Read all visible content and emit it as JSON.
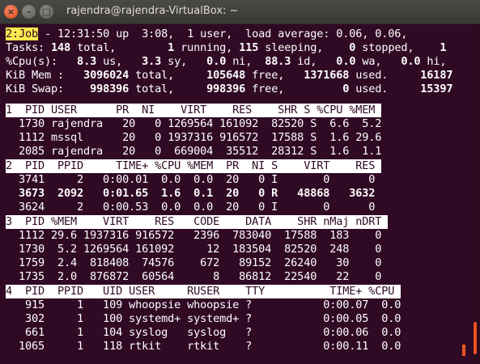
{
  "window": {
    "title": "rajendra@rajendra-VirtualBox: ~",
    "close_glyph": "×",
    "min_glyph": "–",
    "max_glyph": "□"
  },
  "summary": {
    "job_label": "2:Job",
    "line1_rest": " - 12:31:50 up  3:08,  1 user,  load average: 0.06, 0.06,",
    "tasks": {
      "label": "Tasks:",
      "total": "148",
      "running": "1",
      "sleeping": "115",
      "stopped": "0",
      "zombie": "1"
    },
    "cpu": {
      "label": "%Cpu(s):",
      "us": "8.3",
      "sy": "3.3",
      "ni": "0.0",
      "id": "88.3",
      "wa": "0.0",
      "hi": "0.0"
    },
    "mem": {
      "label": "KiB Mem :",
      "total": "3096024",
      "free": "105648",
      "used": "1371668",
      "buff": "16187"
    },
    "swap": {
      "label": "KiB Swap:",
      "total": "998396",
      "free": "998396",
      "used": "0",
      "avail": "15397"
    }
  },
  "window1": {
    "header": "1  PID USER      PR  NI    VIRT    RES    SHR S %CPU %MEM ",
    "rows": [
      {
        "pid": "1730",
        "user": "rajendra",
        "pr": "20",
        "ni": "0",
        "virt": "1269564",
        "res": "161092",
        "shr": "82520",
        "s": "S",
        "cpu": "6.6",
        "mem": "5.2"
      },
      {
        "pid": "1112",
        "user": "mssql",
        "pr": "20",
        "ni": "0",
        "virt": "1937316",
        "res": "916572",
        "shr": "17588",
        "s": "S",
        "cpu": "1.6",
        "mem": "29.6"
      },
      {
        "pid": "2085",
        "user": "rajendra",
        "pr": "20",
        "ni": "0",
        "virt": "669004",
        "res": "35512",
        "shr": "28312",
        "s": "S",
        "cpu": "1.6",
        "mem": "1.1"
      }
    ]
  },
  "window2": {
    "header": "2  PID  PPID     TIME+ %CPU %MEM  PR  NI S    VIRT    RES ",
    "rows": [
      {
        "pid": "3741",
        "ppid": "2",
        "time": "0:00.01",
        "cpu": "0.0",
        "mem": "0.0",
        "pr": "20",
        "ni": "0",
        "s": "I",
        "virt": "0",
        "res": "0",
        "bold": false
      },
      {
        "pid": "3673",
        "ppid": "2092",
        "time": "0:01.65",
        "cpu": "1.6",
        "mem": "0.1",
        "pr": "20",
        "ni": "0",
        "s": "R",
        "virt": "48868",
        "res": "3632",
        "bold": true
      },
      {
        "pid": "3624",
        "ppid": "2",
        "time": "0:00.53",
        "cpu": "0.0",
        "mem": "0.0",
        "pr": "20",
        "ni": "0",
        "s": "I",
        "virt": "0",
        "res": "0",
        "bold": false
      }
    ]
  },
  "window3": {
    "header": "3  PID %MEM    VIRT    RES   CODE    DATA    SHR nMaj nDRT ",
    "rows": [
      {
        "pid": "1112",
        "mem": "29.6",
        "virt": "1937316",
        "res": "916572",
        "code": "2396",
        "data": "783040",
        "shr": "17588",
        "nmaj": "183",
        "ndrt": "0"
      },
      {
        "pid": "1730",
        "mem": "5.2",
        "virt": "1269564",
        "res": "161092",
        "code": "12",
        "data": "183504",
        "shr": "82520",
        "nmaj": "248",
        "ndrt": "0"
      },
      {
        "pid": "1759",
        "mem": "2.4",
        "virt": "818408",
        "res": "74576",
        "code": "672",
        "data": "89152",
        "shr": "26240",
        "nmaj": "30",
        "ndrt": "0"
      },
      {
        "pid": "1735",
        "mem": "2.0",
        "virt": "876872",
        "res": "60564",
        "code": "8",
        "data": "86812",
        "shr": "22540",
        "nmaj": "22",
        "ndrt": "0"
      }
    ]
  },
  "window4": {
    "header": "4  PID  PPID   UID USER     RUSER    TTY          TIME+ %CPU ",
    "rows": [
      {
        "pid": "915",
        "ppid": "1",
        "uid": "109",
        "user": "whoopsie",
        "ruser": "whoopsie",
        "tty": "?",
        "time": "0:00.07",
        "cpu": "0.0"
      },
      {
        "pid": "302",
        "ppid": "1",
        "uid": "100",
        "user": "systemd+",
        "ruser": "systemd+",
        "tty": "?",
        "time": "0:00.05",
        "cpu": "0.0"
      },
      {
        "pid": "661",
        "ppid": "1",
        "uid": "104",
        "user": "syslog",
        "ruser": "syslog",
        "tty": "?",
        "time": "0:00.06",
        "cpu": "0.0"
      },
      {
        "pid": "1065",
        "ppid": "1",
        "uid": "118",
        "user": "rtkit",
        "ruser": "rtkit",
        "tty": "?",
        "time": "0:00.11",
        "cpu": "0.0"
      }
    ]
  },
  "colors": {
    "terminal_bg": "#300a24",
    "text": "#ffffff",
    "job_highlight": "#fce94f",
    "accent": "#e95420"
  }
}
